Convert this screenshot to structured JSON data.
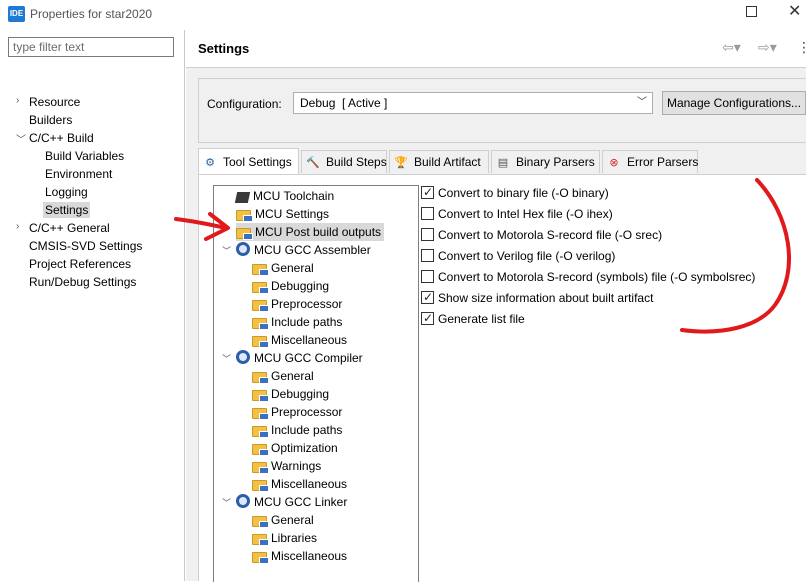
{
  "window": {
    "app_icon": "IDE",
    "title": "Properties for star2020",
    "maximize_icon": "maximize-icon",
    "close_icon": "close-icon",
    "close_glyph": "✕"
  },
  "filter": {
    "placeholder": "type filter text"
  },
  "nav": {
    "items": [
      {
        "label": "Resource",
        "expander": "collapsed"
      },
      {
        "label": "Builders"
      },
      {
        "label": "C/C++ Build",
        "expander": "expanded"
      },
      {
        "label": "Build Variables"
      },
      {
        "label": "Environment"
      },
      {
        "label": "Logging"
      },
      {
        "label": "Settings",
        "selected": true
      },
      {
        "label": "C/C++ General",
        "expander": "collapsed"
      },
      {
        "label": "CMSIS-SVD Settings"
      },
      {
        "label": "Project References"
      },
      {
        "label": "Run/Debug Settings"
      }
    ]
  },
  "header": {
    "title": "Settings",
    "icons": [
      "back-arrow-icon",
      "forward-arrow-icon",
      "view-menu-icon"
    ]
  },
  "configuration": {
    "label": "Configuration:",
    "value": "Debug  [ Active ]",
    "manage_label": "Manage Configurations..."
  },
  "tabs": [
    {
      "label": "Tool Settings",
      "icon": "gear-icon",
      "active": true
    },
    {
      "label": "Build Steps",
      "icon": "hammer-icon"
    },
    {
      "label": "Build Artifact",
      "icon": "trophy-icon"
    },
    {
      "label": "Binary Parsers",
      "icon": "binary-file-icon"
    },
    {
      "label": "Error Parsers",
      "icon": "error-icon"
    }
  ],
  "tool_tree": [
    {
      "label": "MCU Toolchain",
      "icon": "chip-icon"
    },
    {
      "label": "MCU Settings",
      "icon": "settings-folder-icon"
    },
    {
      "label": "MCU Post build outputs",
      "icon": "settings-folder-icon",
      "selected": true
    },
    {
      "label": "MCU GCC Assembler",
      "icon": "gear-icon",
      "expander": "expanded"
    },
    {
      "label": "General",
      "icon": "settings-folder-icon"
    },
    {
      "label": "Debugging",
      "icon": "settings-folder-icon"
    },
    {
      "label": "Preprocessor",
      "icon": "settings-folder-icon"
    },
    {
      "label": "Include paths",
      "icon": "settings-folder-icon"
    },
    {
      "label": "Miscellaneous",
      "icon": "settings-folder-icon"
    },
    {
      "label": "MCU GCC Compiler",
      "icon": "gear-icon",
      "expander": "expanded"
    },
    {
      "label": "General",
      "icon": "settings-folder-icon"
    },
    {
      "label": "Debugging",
      "icon": "settings-folder-icon"
    },
    {
      "label": "Preprocessor",
      "icon": "settings-folder-icon"
    },
    {
      "label": "Include paths",
      "icon": "settings-folder-icon"
    },
    {
      "label": "Optimization",
      "icon": "settings-folder-icon"
    },
    {
      "label": "Warnings",
      "icon": "settings-folder-icon"
    },
    {
      "label": "Miscellaneous",
      "icon": "settings-folder-icon"
    },
    {
      "label": "MCU GCC Linker",
      "icon": "gear-icon",
      "expander": "expanded"
    },
    {
      "label": "General",
      "icon": "settings-folder-icon"
    },
    {
      "label": "Libraries",
      "icon": "settings-folder-icon"
    },
    {
      "label": "Miscellaneous",
      "icon": "settings-folder-icon"
    }
  ],
  "options": [
    {
      "label": "Convert to binary file (-O binary)",
      "checked": true
    },
    {
      "label": "Convert to Intel Hex file (-O ihex)",
      "checked": false
    },
    {
      "label": "Convert to Motorola S-record file (-O srec)",
      "checked": false
    },
    {
      "label": "Convert to Verilog file (-O verilog)",
      "checked": false
    },
    {
      "label": "Convert to Motorola S-record (symbols) file (-O symbolsrec)",
      "checked": false
    },
    {
      "label": "Show size information about built artifact",
      "checked": true
    },
    {
      "label": "Generate list file",
      "checked": true
    }
  ],
  "annotation_color": "#e0191c"
}
